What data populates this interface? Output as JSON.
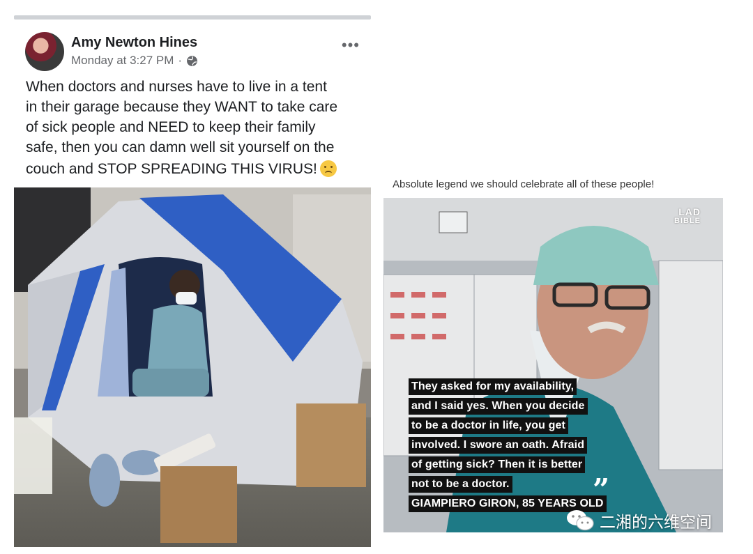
{
  "post": {
    "author": "Amy Newton Hines",
    "timestamp": "Monday at 3:27 PM",
    "separator": "·",
    "privacy_icon": "globe-icon",
    "more_icon": "more-options-icon",
    "more_label": "•••",
    "text_lines": [
      "When doctors and nurses have to live in a tent",
      "in their garage because they WANT to take care",
      "of sick people and NEED to keep their family",
      "safe, then you can damn well sit yourself on the",
      "couch and STOP SPREADING THIS VIRUS!"
    ],
    "emoji": "crying-face-emoji"
  },
  "meme": {
    "caption": "Absolute legend we should celebrate all of these people!",
    "logo_line1": "LAD",
    "logo_line2": "BIBLE",
    "quote_lines": [
      "They asked for my availability,",
      "and I said yes. When you decide",
      "to be a doctor in life, you get",
      "involved. I swore an oath. Afraid",
      "of getting sick? Then it is better",
      "not to be a doctor.",
      "GIAMPIERO GIRON, 85 YEARS OLD"
    ],
    "quote_mark": "”"
  },
  "watermark": {
    "icon": "wechat-icon",
    "text": "二湘的六维空间"
  },
  "colors": {
    "tent_blue": "#2f5fc4",
    "scrubs": "#7aa8b8",
    "cap": "#8ec8c0"
  }
}
